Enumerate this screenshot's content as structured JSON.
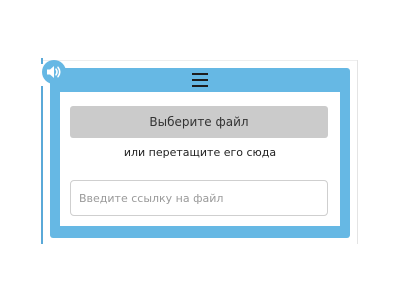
{
  "widget": {
    "menu_icon": "hamburger-icon",
    "sound_icon": "speaker-icon",
    "choose_file_label": "Выберите файл",
    "drag_hint": "или перетащите его сюда",
    "url_input": {
      "value": "",
      "placeholder": "Введите ссылку на файл"
    }
  },
  "colors": {
    "frame": "#66b8e4",
    "button": "#cbcbcb",
    "panel": "#ffffff"
  }
}
